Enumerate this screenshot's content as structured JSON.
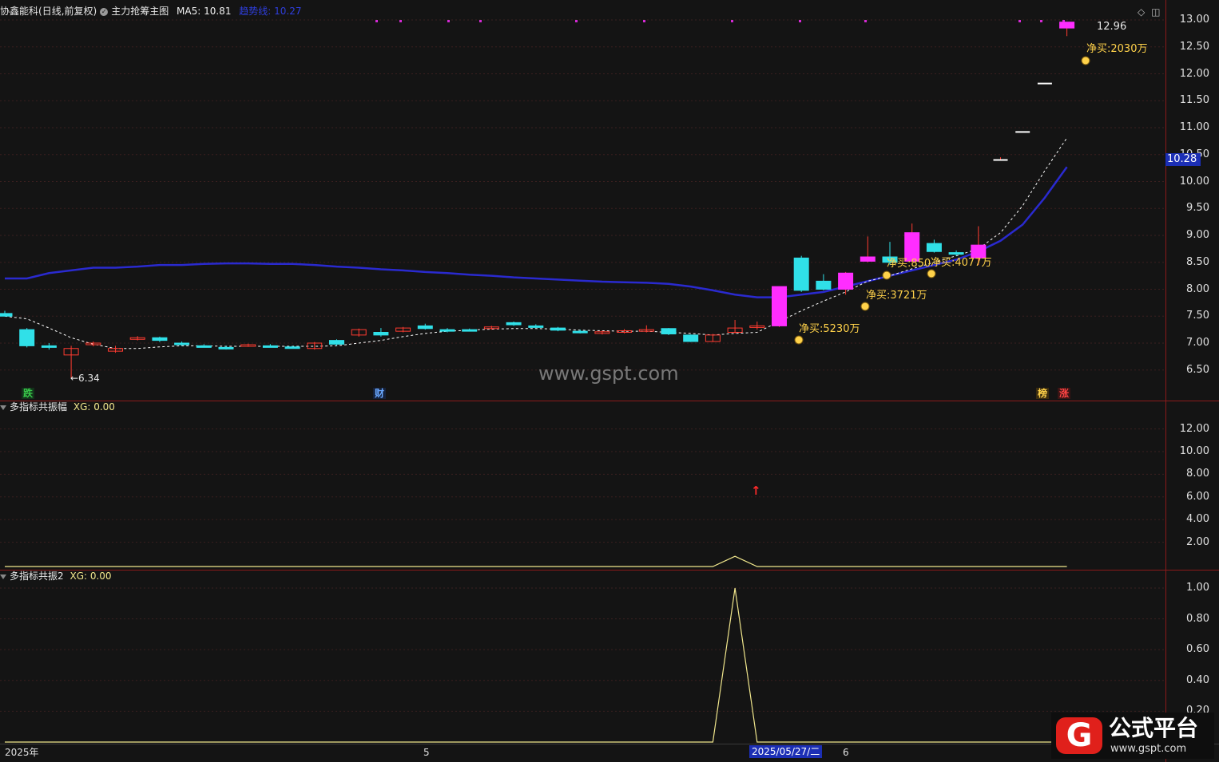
{
  "colors": {
    "background": "#141414",
    "up": "#ff3b30",
    "up_fill": "#ff2dff",
    "down": "#30e0e8",
    "trend": "#2a2acf",
    "ma5": "#ffffff",
    "indicator": "#f0e68c",
    "net_buy": "#ffd24a",
    "separator": "#8b1a1a",
    "price_tag_bg": "#1c2fb5"
  },
  "main_panel": {
    "stock_name": "协鑫能科",
    "period": "(日线,前复权)",
    "indicator_name": "主力抢筹主图",
    "ma5_label": "MA5: 10.81",
    "trend_label": "趋势线: 10.27",
    "low_label": "←6.34",
    "high_label": "12.96",
    "current_price": "10.28",
    "net_buy_labels": [
      "净买:5230万",
      "净买:3721万",
      "净买:850",
      "净买:4077万",
      "净买:2030万"
    ],
    "bottom_badges": [
      "跌",
      "财",
      "榜",
      "涨"
    ],
    "y_ticks": [
      "13.00",
      "12.50",
      "12.00",
      "11.50",
      "11.00",
      "10.50",
      "10.00",
      "9.50",
      "9.00",
      "8.50",
      "8.00",
      "7.50",
      "7.00",
      "6.50"
    ],
    "candles": [
      {
        "o": 7.55,
        "h": 7.6,
        "l": 7.5,
        "c": 7.5
      },
      {
        "o": 7.25,
        "h": 7.28,
        "l": 6.92,
        "c": 6.95
      },
      {
        "o": 6.95,
        "h": 7.0,
        "l": 6.88,
        "c": 6.93
      },
      {
        "o": 6.78,
        "h": 6.95,
        "l": 6.34,
        "c": 6.9
      },
      {
        "o": 6.98,
        "h": 7.03,
        "l": 6.94,
        "c": 7.0
      },
      {
        "o": 6.85,
        "h": 6.95,
        "l": 6.82,
        "c": 6.9
      },
      {
        "o": 7.08,
        "h": 7.13,
        "l": 7.05,
        "c": 7.1
      },
      {
        "o": 7.1,
        "h": 7.12,
        "l": 7.02,
        "c": 7.05
      },
      {
        "o": 7.0,
        "h": 7.03,
        "l": 6.95,
        "c": 6.99
      },
      {
        "o": 6.95,
        "h": 6.98,
        "l": 6.92,
        "c": 6.94
      },
      {
        "o": 6.92,
        "h": 6.95,
        "l": 6.88,
        "c": 6.9
      },
      {
        "o": 6.96,
        "h": 6.99,
        "l": 6.93,
        "c": 6.97
      },
      {
        "o": 6.95,
        "h": 6.98,
        "l": 6.92,
        "c": 6.93
      },
      {
        "o": 6.93,
        "h": 6.95,
        "l": 6.9,
        "c": 6.92
      },
      {
        "o": 6.9,
        "h": 7.02,
        "l": 6.88,
        "c": 7.0
      },
      {
        "o": 7.05,
        "h": 7.07,
        "l": 6.95,
        "c": 6.98
      },
      {
        "o": 7.15,
        "h": 7.27,
        "l": 7.12,
        "c": 7.25
      },
      {
        "o": 7.2,
        "h": 7.28,
        "l": 7.12,
        "c": 7.15
      },
      {
        "o": 7.22,
        "h": 7.3,
        "l": 7.2,
        "c": 7.28
      },
      {
        "o": 7.32,
        "h": 7.36,
        "l": 7.25,
        "c": 7.27
      },
      {
        "o": 7.25,
        "h": 7.28,
        "l": 7.2,
        "c": 7.24
      },
      {
        "o": 7.25,
        "h": 7.27,
        "l": 7.22,
        "c": 7.23
      },
      {
        "o": 7.28,
        "h": 7.32,
        "l": 7.25,
        "c": 7.3
      },
      {
        "o": 7.38,
        "h": 7.4,
        "l": 7.32,
        "c": 7.34
      },
      {
        "o": 7.32,
        "h": 7.35,
        "l": 7.28,
        "c": 7.3
      },
      {
        "o": 7.28,
        "h": 7.3,
        "l": 7.22,
        "c": 7.24
      },
      {
        "o": 7.22,
        "h": 7.25,
        "l": 7.18,
        "c": 7.2
      },
      {
        "o": 7.18,
        "h": 7.23,
        "l": 7.16,
        "c": 7.21
      },
      {
        "o": 7.2,
        "h": 7.26,
        "l": 7.18,
        "c": 7.23
      },
      {
        "o": 7.22,
        "h": 7.33,
        "l": 7.2,
        "c": 7.25
      },
      {
        "o": 7.27,
        "h": 7.28,
        "l": 7.15,
        "c": 7.17
      },
      {
        "o": 7.15,
        "h": 7.16,
        "l": 7.02,
        "c": 7.03
      },
      {
        "o": 7.03,
        "h": 7.17,
        "l": 7.02,
        "c": 7.15
      },
      {
        "o": 7.2,
        "h": 7.43,
        "l": 7.18,
        "c": 7.28
      },
      {
        "o": 7.3,
        "h": 7.4,
        "l": 7.25,
        "c": 7.32
      },
      {
        "o": 7.32,
        "h": 8.05,
        "l": 7.3,
        "c": 8.05
      },
      {
        "o": 8.58,
        "h": 8.62,
        "l": 7.95,
        "c": 7.98
      },
      {
        "o": 8.15,
        "h": 8.28,
        "l": 7.98,
        "c": 8.0
      },
      {
        "o": 8.0,
        "h": 8.32,
        "l": 7.9,
        "c": 8.3
      },
      {
        "o": 8.52,
        "h": 8.98,
        "l": 8.5,
        "c": 8.6
      },
      {
        "o": 8.6,
        "h": 8.88,
        "l": 8.45,
        "c": 8.5
      },
      {
        "o": 8.52,
        "h": 9.22,
        "l": 8.5,
        "c": 9.05
      },
      {
        "o": 8.85,
        "h": 8.92,
        "l": 8.68,
        "c": 8.7
      },
      {
        "o": 8.68,
        "h": 8.72,
        "l": 8.62,
        "c": 8.65
      },
      {
        "o": 8.58,
        "h": 9.17,
        "l": 8.45,
        "c": 8.82
      },
      {
        "o": 10.4,
        "h": 10.45,
        "l": 10.4,
        "c": 10.4
      },
      {
        "o": 10.92,
        "h": 10.92,
        "l": 10.92,
        "c": 10.92
      },
      {
        "o": 11.82,
        "h": 11.82,
        "l": 11.82,
        "c": 11.82
      },
      {
        "o": 12.85,
        "h": 12.96,
        "l": 12.7,
        "c": 12.96
      }
    ],
    "trend_line": [
      8.2,
      8.2,
      8.3,
      8.35,
      8.4,
      8.4,
      8.42,
      8.45,
      8.45,
      8.47,
      8.48,
      8.48,
      8.47,
      8.47,
      8.45,
      8.42,
      8.4,
      8.37,
      8.35,
      8.32,
      8.3,
      8.27,
      8.25,
      8.22,
      8.2,
      8.18,
      8.16,
      8.14,
      8.13,
      8.12,
      8.1,
      8.05,
      7.98,
      7.9,
      7.85,
      7.85,
      7.9,
      7.95,
      8.05,
      8.15,
      8.25,
      8.35,
      8.45,
      8.55,
      8.7,
      8.9,
      9.2,
      9.7,
      10.27
    ],
    "ma5_line": [
      7.5,
      7.45,
      7.28,
      7.1,
      6.98,
      6.9,
      6.9,
      6.93,
      6.95,
      6.95,
      6.94,
      6.94,
      6.94,
      6.94,
      6.94,
      6.95,
      7.0,
      7.05,
      7.12,
      7.18,
      7.22,
      7.24,
      7.26,
      7.27,
      7.27,
      7.26,
      7.24,
      7.23,
      7.22,
      7.22,
      7.2,
      7.18,
      7.15,
      7.18,
      7.2,
      7.4,
      7.6,
      7.78,
      7.95,
      8.15,
      8.25,
      8.38,
      8.5,
      8.62,
      8.75,
      9.05,
      9.55,
      10.2,
      10.81
    ]
  },
  "panel2": {
    "name": "多指标共振幅",
    "xg_label": "XG: 0.00",
    "y_ticks": [
      "12.00",
      "10.00",
      "8.00",
      "6.00",
      "4.00",
      "2.00"
    ],
    "signal_arrow": "↑",
    "series": [
      0,
      0,
      0,
      0,
      0,
      0,
      0,
      0,
      0,
      0,
      0,
      0,
      0,
      0,
      0,
      0,
      0,
      0,
      0,
      0,
      0,
      0,
      0,
      0,
      0,
      0,
      0,
      0,
      0,
      0,
      0,
      0,
      0,
      1.0,
      0,
      0,
      0,
      0,
      0,
      0,
      0,
      0,
      0,
      0,
      0,
      0,
      0,
      0,
      0
    ]
  },
  "panel3": {
    "name": "多指标共振2",
    "xg_label": "XG: 0.00",
    "y_ticks": [
      "1.00",
      "0.80",
      "0.60",
      "0.40",
      "0.20"
    ],
    "series": [
      0,
      0,
      0,
      0,
      0,
      0,
      0,
      0,
      0,
      0,
      0,
      0,
      0,
      0,
      0,
      0,
      0,
      0,
      0,
      0,
      0,
      0,
      0,
      0,
      0,
      0,
      0,
      0,
      0,
      0,
      0,
      0,
      0,
      1.0,
      0,
      0,
      0,
      0,
      0,
      0,
      0,
      0,
      0,
      0,
      0,
      0,
      0,
      0,
      0
    ]
  },
  "x_axis": {
    "labels": [
      "2025年",
      "5",
      "2025/05/27/二",
      "6"
    ]
  },
  "watermark": {
    "center": "www.gspt.com",
    "logo_cn": "公式平台",
    "logo_url": "www.gspt.com"
  }
}
